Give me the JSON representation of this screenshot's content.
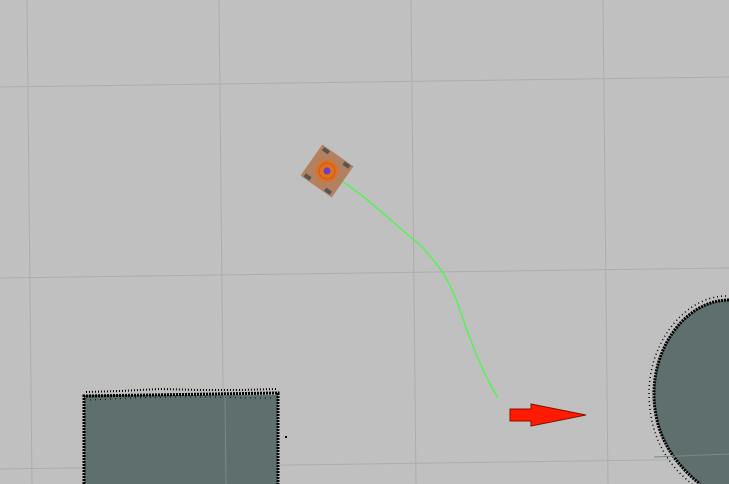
{
  "viewport": {
    "background_color": "#c0c0c0",
    "grid_line_color": "#adadad",
    "obstacle_fill_color": "#5f6f6d",
    "obstacle_edge_color": "#000000",
    "path_color": "#3cff3c",
    "goal_arrow_color": "#ff1a00",
    "robot_body_color": "#b37a55",
    "robot_core_color": "#e07020",
    "robot_center_color": "#6a40c0",
    "robot_wheel_color": "#555555"
  },
  "icons": {
    "robot": "robot-footprint-icon",
    "goal": "goal-arrow-icon"
  }
}
